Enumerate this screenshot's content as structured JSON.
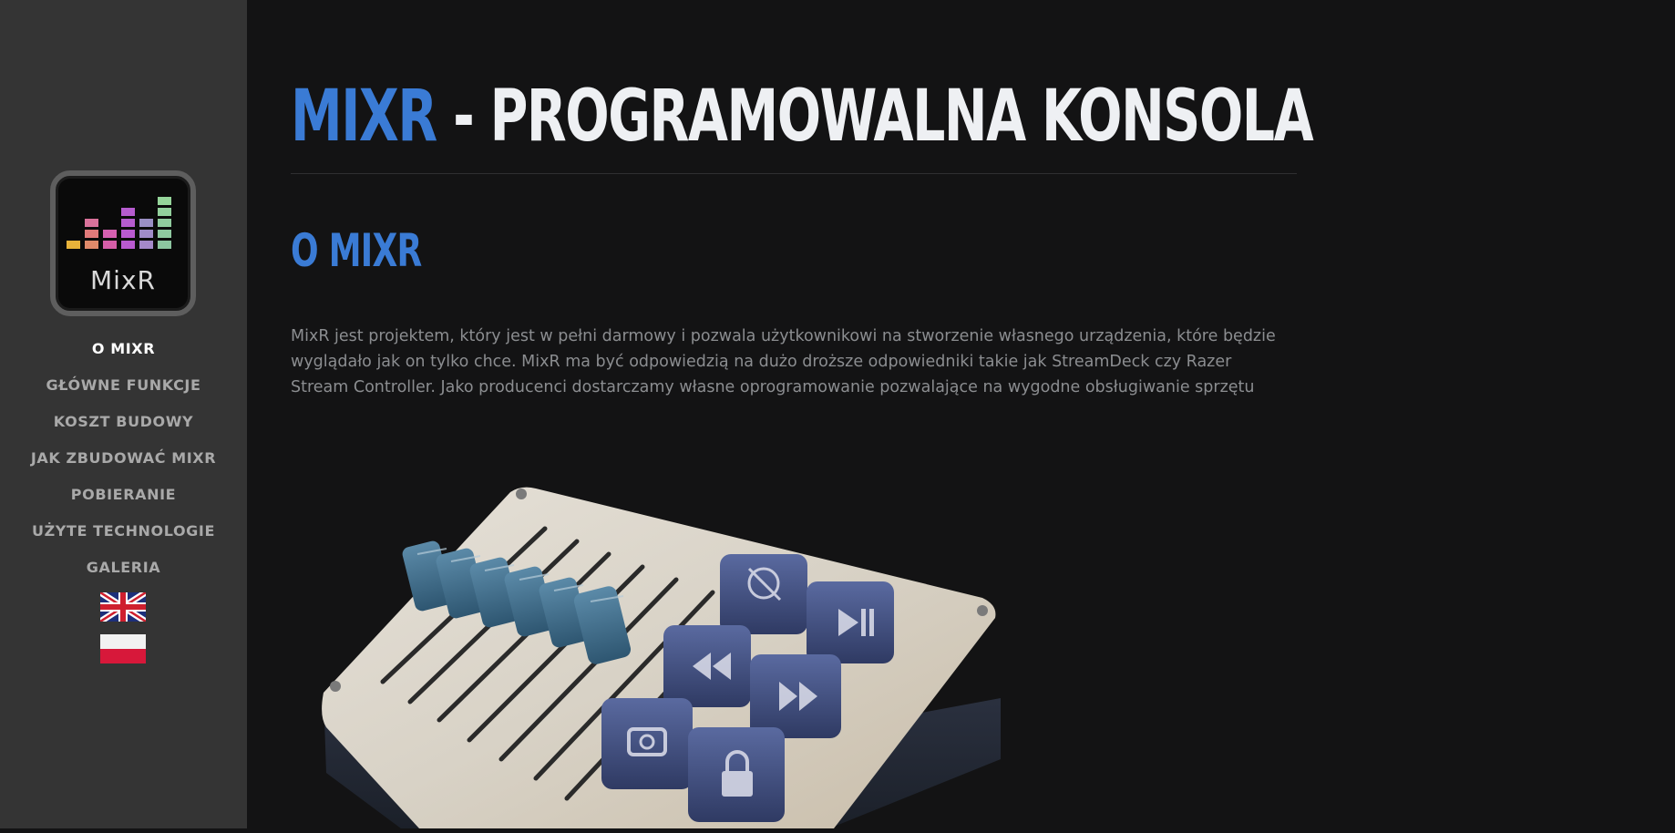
{
  "sidebar": {
    "logo_text": "MixR",
    "nav": [
      {
        "label": "O MIXR",
        "active": true
      },
      {
        "label": "GŁÓWNE FUNKCJE",
        "active": false
      },
      {
        "label": "KOSZT BUDOWY",
        "active": false
      },
      {
        "label": "JAK ZBUDOWAĆ MIXR",
        "active": false
      },
      {
        "label": "POBIERANIE",
        "active": false
      },
      {
        "label": "UŻYTE TECHNOLOGIE",
        "active": false
      },
      {
        "label": "GALERIA",
        "active": false
      }
    ],
    "languages": [
      "english-flag",
      "polish-flag"
    ]
  },
  "main": {
    "title_brand": "MIXR",
    "title_rest": " - PROGRAMOWALNA KONSOLA",
    "section_title": "O MIXR",
    "section_text": "MixR jest projektem, który jest w pełni darmowy i pozwala użytkownikowi na stworzenie własnego urządzenia, które będzie wyglądało jak on tylko chce. MixR ma być odpowiedzią na dużo droższe odpowiedniki takie jak StreamDeck czy Razer Stream Controller. Jako producenci dostarczamy własne oprogramowanie pozwalające na wygodne obsługiwanie sprzętu"
  },
  "colors": {
    "background": "#131314",
    "sidebar": "#343434",
    "accent": "#3a7bd5",
    "title_text": "#eef0f3",
    "body_text": "#8b8d90",
    "nav_text": "#a9a9a9",
    "nav_active": "#ffffff"
  }
}
